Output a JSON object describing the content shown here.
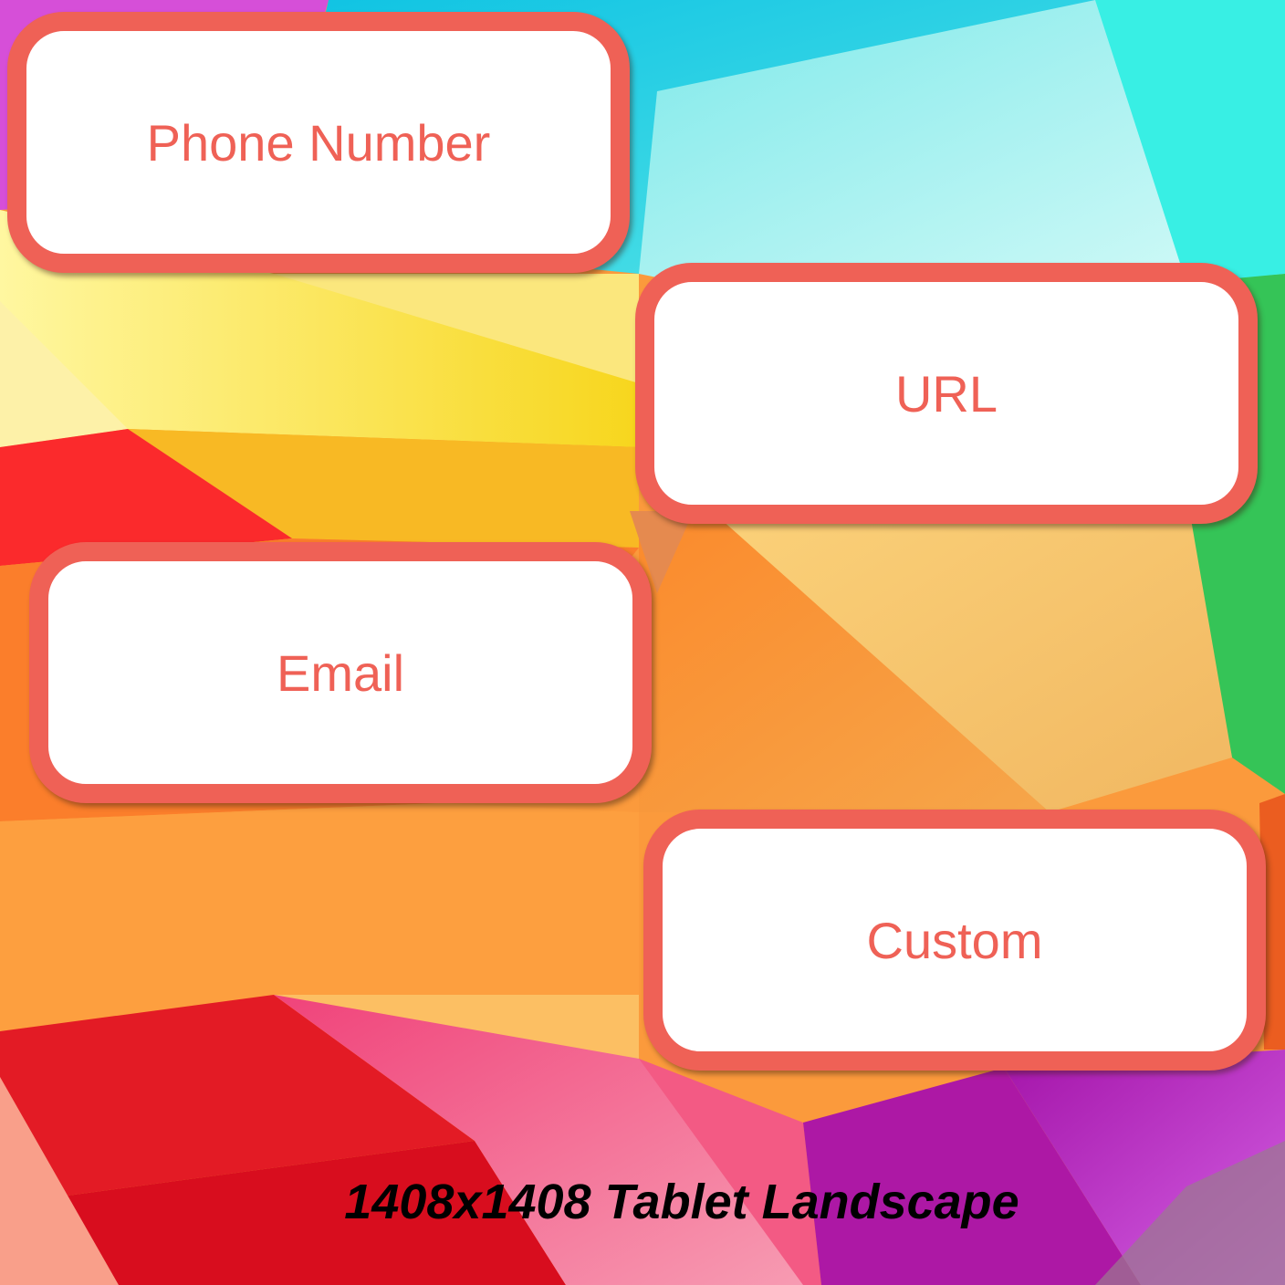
{
  "buttons": {
    "phone_label": "Phone Number",
    "url_label": "URL",
    "email_label": "Email",
    "custom_label": "Custom"
  },
  "caption": "1408x1408 Tablet Landscape",
  "colors": {
    "button_border": "#ef6156",
    "button_text": "#ef6156",
    "button_fill": "#ffffff",
    "caption_text": "#000000"
  }
}
